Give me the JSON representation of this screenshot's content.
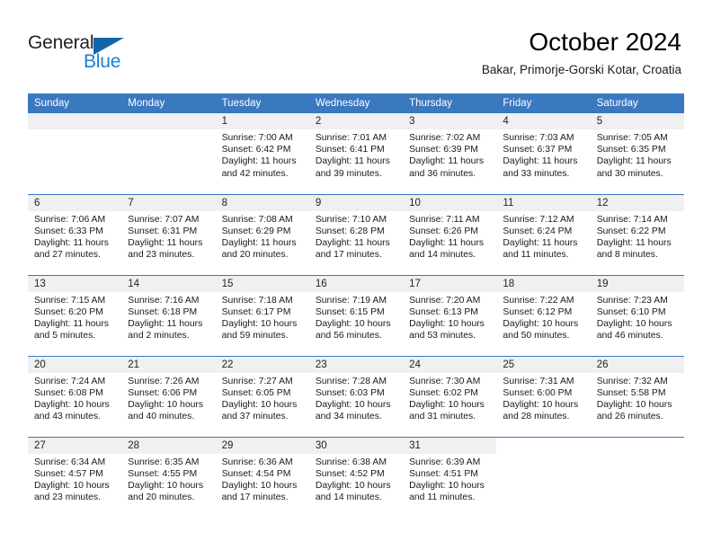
{
  "brand": {
    "name_top": "General",
    "name_bottom": "Blue",
    "accent_color": "#1464aa",
    "blue_text_color": "#1b7fd4"
  },
  "header": {
    "title": "October 2024",
    "subtitle": "Bakar, Primorje-Gorski Kotar, Croatia"
  },
  "theme": {
    "header_bg": "#3a78c0",
    "daynum_bg": "#f0f0f0",
    "cell_bg": "#ffffff"
  },
  "weekdays": [
    "Sunday",
    "Monday",
    "Tuesday",
    "Wednesday",
    "Thursday",
    "Friday",
    "Saturday"
  ],
  "labels": {
    "sunrise_prefix": "Sunrise:",
    "sunset_prefix": "Sunset:",
    "daylight_prefix": "Daylight:"
  },
  "weeks": [
    [
      {
        "day": "",
        "sunrise": "",
        "sunset": "",
        "daylight_1": "",
        "daylight_2": ""
      },
      {
        "day": "",
        "sunrise": "",
        "sunset": "",
        "daylight_1": "",
        "daylight_2": ""
      },
      {
        "day": "1",
        "sunrise": "Sunrise: 7:00 AM",
        "sunset": "Sunset: 6:42 PM",
        "daylight_1": "Daylight: 11 hours",
        "daylight_2": "and 42 minutes."
      },
      {
        "day": "2",
        "sunrise": "Sunrise: 7:01 AM",
        "sunset": "Sunset: 6:41 PM",
        "daylight_1": "Daylight: 11 hours",
        "daylight_2": "and 39 minutes."
      },
      {
        "day": "3",
        "sunrise": "Sunrise: 7:02 AM",
        "sunset": "Sunset: 6:39 PM",
        "daylight_1": "Daylight: 11 hours",
        "daylight_2": "and 36 minutes."
      },
      {
        "day": "4",
        "sunrise": "Sunrise: 7:03 AM",
        "sunset": "Sunset: 6:37 PM",
        "daylight_1": "Daylight: 11 hours",
        "daylight_2": "and 33 minutes."
      },
      {
        "day": "5",
        "sunrise": "Sunrise: 7:05 AM",
        "sunset": "Sunset: 6:35 PM",
        "daylight_1": "Daylight: 11 hours",
        "daylight_2": "and 30 minutes."
      }
    ],
    [
      {
        "day": "6",
        "sunrise": "Sunrise: 7:06 AM",
        "sunset": "Sunset: 6:33 PM",
        "daylight_1": "Daylight: 11 hours",
        "daylight_2": "and 27 minutes."
      },
      {
        "day": "7",
        "sunrise": "Sunrise: 7:07 AM",
        "sunset": "Sunset: 6:31 PM",
        "daylight_1": "Daylight: 11 hours",
        "daylight_2": "and 23 minutes."
      },
      {
        "day": "8",
        "sunrise": "Sunrise: 7:08 AM",
        "sunset": "Sunset: 6:29 PM",
        "daylight_1": "Daylight: 11 hours",
        "daylight_2": "and 20 minutes."
      },
      {
        "day": "9",
        "sunrise": "Sunrise: 7:10 AM",
        "sunset": "Sunset: 6:28 PM",
        "daylight_1": "Daylight: 11 hours",
        "daylight_2": "and 17 minutes."
      },
      {
        "day": "10",
        "sunrise": "Sunrise: 7:11 AM",
        "sunset": "Sunset: 6:26 PM",
        "daylight_1": "Daylight: 11 hours",
        "daylight_2": "and 14 minutes."
      },
      {
        "day": "11",
        "sunrise": "Sunrise: 7:12 AM",
        "sunset": "Sunset: 6:24 PM",
        "daylight_1": "Daylight: 11 hours",
        "daylight_2": "and 11 minutes."
      },
      {
        "day": "12",
        "sunrise": "Sunrise: 7:14 AM",
        "sunset": "Sunset: 6:22 PM",
        "daylight_1": "Daylight: 11 hours",
        "daylight_2": "and 8 minutes."
      }
    ],
    [
      {
        "day": "13",
        "sunrise": "Sunrise: 7:15 AM",
        "sunset": "Sunset: 6:20 PM",
        "daylight_1": "Daylight: 11 hours",
        "daylight_2": "and 5 minutes."
      },
      {
        "day": "14",
        "sunrise": "Sunrise: 7:16 AM",
        "sunset": "Sunset: 6:18 PM",
        "daylight_1": "Daylight: 11 hours",
        "daylight_2": "and 2 minutes."
      },
      {
        "day": "15",
        "sunrise": "Sunrise: 7:18 AM",
        "sunset": "Sunset: 6:17 PM",
        "daylight_1": "Daylight: 10 hours",
        "daylight_2": "and 59 minutes."
      },
      {
        "day": "16",
        "sunrise": "Sunrise: 7:19 AM",
        "sunset": "Sunset: 6:15 PM",
        "daylight_1": "Daylight: 10 hours",
        "daylight_2": "and 56 minutes."
      },
      {
        "day": "17",
        "sunrise": "Sunrise: 7:20 AM",
        "sunset": "Sunset: 6:13 PM",
        "daylight_1": "Daylight: 10 hours",
        "daylight_2": "and 53 minutes."
      },
      {
        "day": "18",
        "sunrise": "Sunrise: 7:22 AM",
        "sunset": "Sunset: 6:12 PM",
        "daylight_1": "Daylight: 10 hours",
        "daylight_2": "and 50 minutes."
      },
      {
        "day": "19",
        "sunrise": "Sunrise: 7:23 AM",
        "sunset": "Sunset: 6:10 PM",
        "daylight_1": "Daylight: 10 hours",
        "daylight_2": "and 46 minutes."
      }
    ],
    [
      {
        "day": "20",
        "sunrise": "Sunrise: 7:24 AM",
        "sunset": "Sunset: 6:08 PM",
        "daylight_1": "Daylight: 10 hours",
        "daylight_2": "and 43 minutes."
      },
      {
        "day": "21",
        "sunrise": "Sunrise: 7:26 AM",
        "sunset": "Sunset: 6:06 PM",
        "daylight_1": "Daylight: 10 hours",
        "daylight_2": "and 40 minutes."
      },
      {
        "day": "22",
        "sunrise": "Sunrise: 7:27 AM",
        "sunset": "Sunset: 6:05 PM",
        "daylight_1": "Daylight: 10 hours",
        "daylight_2": "and 37 minutes."
      },
      {
        "day": "23",
        "sunrise": "Sunrise: 7:28 AM",
        "sunset": "Sunset: 6:03 PM",
        "daylight_1": "Daylight: 10 hours",
        "daylight_2": "and 34 minutes."
      },
      {
        "day": "24",
        "sunrise": "Sunrise: 7:30 AM",
        "sunset": "Sunset: 6:02 PM",
        "daylight_1": "Daylight: 10 hours",
        "daylight_2": "and 31 minutes."
      },
      {
        "day": "25",
        "sunrise": "Sunrise: 7:31 AM",
        "sunset": "Sunset: 6:00 PM",
        "daylight_1": "Daylight: 10 hours",
        "daylight_2": "and 28 minutes."
      },
      {
        "day": "26",
        "sunrise": "Sunrise: 7:32 AM",
        "sunset": "Sunset: 5:58 PM",
        "daylight_1": "Daylight: 10 hours",
        "daylight_2": "and 26 minutes."
      }
    ],
    [
      {
        "day": "27",
        "sunrise": "Sunrise: 6:34 AM",
        "sunset": "Sunset: 4:57 PM",
        "daylight_1": "Daylight: 10 hours",
        "daylight_2": "and 23 minutes."
      },
      {
        "day": "28",
        "sunrise": "Sunrise: 6:35 AM",
        "sunset": "Sunset: 4:55 PM",
        "daylight_1": "Daylight: 10 hours",
        "daylight_2": "and 20 minutes."
      },
      {
        "day": "29",
        "sunrise": "Sunrise: 6:36 AM",
        "sunset": "Sunset: 4:54 PM",
        "daylight_1": "Daylight: 10 hours",
        "daylight_2": "and 17 minutes."
      },
      {
        "day": "30",
        "sunrise": "Sunrise: 6:38 AM",
        "sunset": "Sunset: 4:52 PM",
        "daylight_1": "Daylight: 10 hours",
        "daylight_2": "and 14 minutes."
      },
      {
        "day": "31",
        "sunrise": "Sunrise: 6:39 AM",
        "sunset": "Sunset: 4:51 PM",
        "daylight_1": "Daylight: 10 hours",
        "daylight_2": "and 11 minutes."
      },
      {
        "day": "",
        "sunrise": "",
        "sunset": "",
        "daylight_1": "",
        "daylight_2": ""
      },
      {
        "day": "",
        "sunrise": "",
        "sunset": "",
        "daylight_1": "",
        "daylight_2": ""
      }
    ]
  ]
}
